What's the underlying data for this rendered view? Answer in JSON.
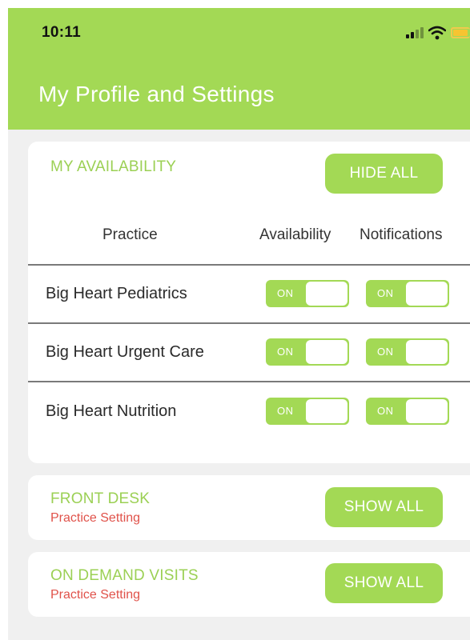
{
  "status_bar": {
    "time": "10:11",
    "icons": [
      "signal-icon",
      "wifi-icon",
      "battery-icon"
    ]
  },
  "header": {
    "title": "My Profile and Settings"
  },
  "colors": {
    "accent": "#a3d955",
    "section_title": "#9bd054",
    "subtitle": "#e0524a",
    "background": "#f0f0f0"
  },
  "availability": {
    "title": "MY AVAILABILITY",
    "button_label": "HIDE ALL",
    "columns": [
      "Practice",
      "Availability",
      "Notifications"
    ],
    "rows": [
      {
        "practice": "Big Heart Pediatrics",
        "availability": "ON",
        "notifications": "ON"
      },
      {
        "practice": "Big Heart Urgent Care",
        "availability": "ON",
        "notifications": "ON"
      },
      {
        "practice": "Big Heart Nutrition",
        "availability": "ON",
        "notifications": "ON"
      }
    ]
  },
  "front_desk": {
    "title": "FRONT DESK",
    "subtitle": "Practice Setting",
    "button_label": "SHOW ALL"
  },
  "on_demand": {
    "title": "ON DEMAND VISITS",
    "subtitle": "Practice Setting",
    "button_label": "SHOW ALL"
  }
}
